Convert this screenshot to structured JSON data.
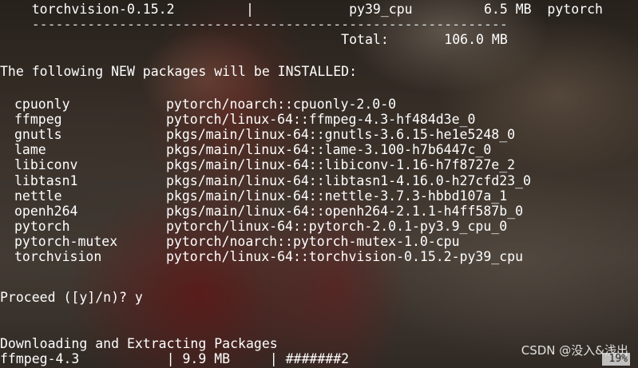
{
  "terminal": {
    "header_row": "    torchvision-0.15.2         |            py39_cpu         6.5 MB  pytorch",
    "separator_row": "    ------------------------------------------------------------",
    "total_row": "                                           Total:       106.0 MB",
    "new_packages_heading": "The following NEW packages will be INSTALLED:",
    "packages": [
      {
        "name": "cpuonly",
        "spec": "pytorch/noarch::cpuonly-2.0-0"
      },
      {
        "name": "ffmpeg",
        "spec": "pytorch/linux-64::ffmpeg-4.3-hf484d3e_0"
      },
      {
        "name": "gnutls",
        "spec": "pkgs/main/linux-64::gnutls-3.6.15-he1e5248_0"
      },
      {
        "name": "lame",
        "spec": "pkgs/main/linux-64::lame-3.100-h7b6447c_0"
      },
      {
        "name": "libiconv",
        "spec": "pkgs/main/linux-64::libiconv-1.16-h7f8727e_2"
      },
      {
        "name": "libtasn1",
        "spec": "pkgs/main/linux-64::libtasn1-4.16.0-h27cfd23_0"
      },
      {
        "name": "nettle",
        "spec": "pkgs/main/linux-64::nettle-3.7.3-hbbd107a_1"
      },
      {
        "name": "openh264",
        "spec": "pkgs/main/linux-64::openh264-2.1.1-h4ff587b_0"
      },
      {
        "name": "pytorch",
        "spec": "pytorch/linux-64::pytorch-2.0.1-py3.9_cpu_0"
      },
      {
        "name": "pytorch-mutex",
        "spec": "pytorch/noarch::pytorch-mutex-1.0-cpu"
      },
      {
        "name": "torchvision",
        "spec": "pytorch/linux-64::torchvision-0.15.2-py39_cpu"
      }
    ],
    "proceed_prompt": "Proceed ([y]/n)? y",
    "downloading_heading": "Downloading and Extracting Packages",
    "progress_row": "ffmpeg-4.3           | 9.9 MB     | #######2",
    "progress_percent": "19%"
  },
  "watermark": "CSDN @没入&浅出",
  "colors": {
    "text": "#ffffff",
    "background": "#1a1410"
  }
}
